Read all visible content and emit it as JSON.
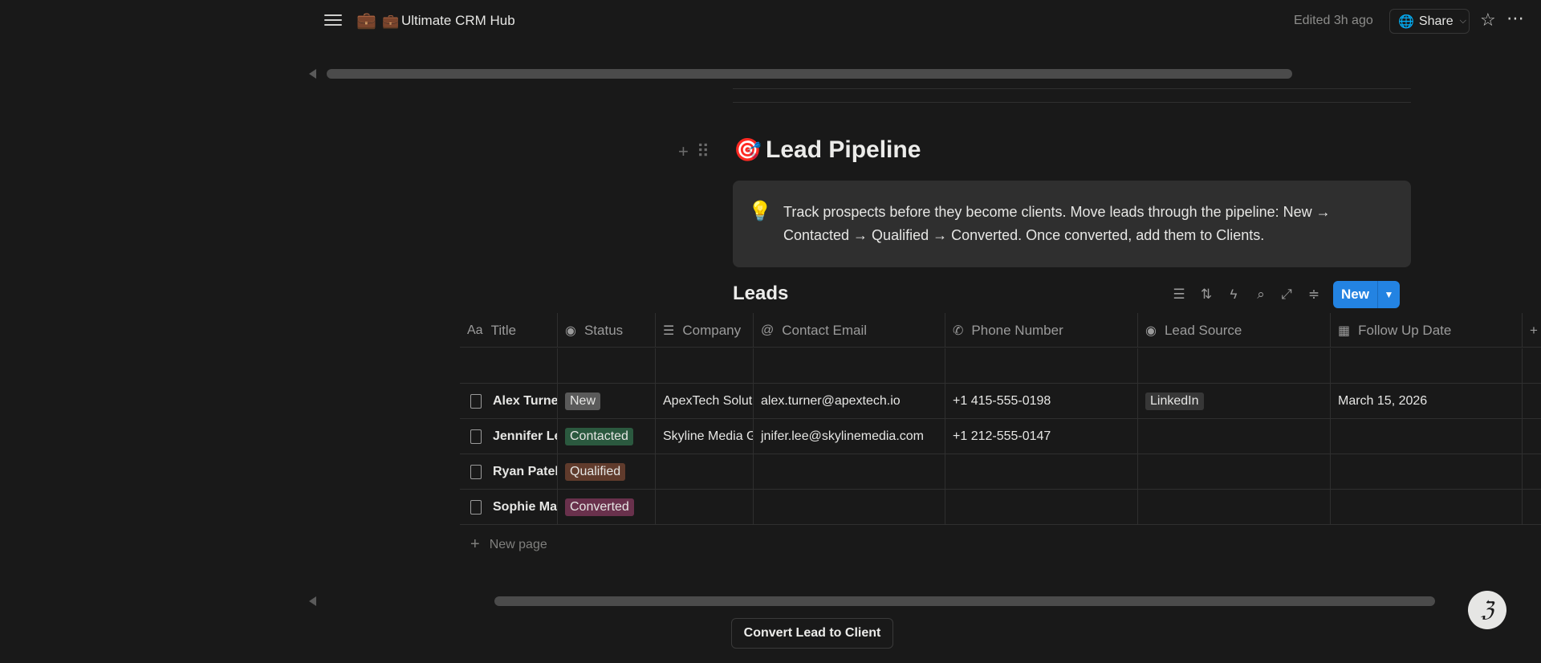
{
  "topbar": {
    "app_title": "Ultimate CRM Hub",
    "edited": "Edited 3h ago",
    "share_label": "Share"
  },
  "page": {
    "heading": "Lead Pipeline",
    "callout": "Track prospects before they become clients. Move leads through the pipeline: New → Contacted → Qualified → Converted. Once converted, add them to Clients."
  },
  "database": {
    "title": "Leads",
    "new_label": "New",
    "columns": [
      "Title",
      "Status",
      "Company",
      "Contact Email",
      "Phone Number",
      "Lead Source",
      "Follow Up Date"
    ],
    "rows": [
      {
        "title": "Alex Turner",
        "status": "New",
        "company": "ApexTech Solutions",
        "email": "alex.turner@apextech.io",
        "phone": "+1 415-555-0198",
        "source": "LinkedIn",
        "follow_up": "March 15, 2026"
      },
      {
        "title": "Jennifer Lee",
        "status": "Contacted",
        "company": "Skyline Media Group",
        "email": "jnifer.lee@skylinemedia.com",
        "phone": "+1 212-555-0147",
        "source": "",
        "follow_up": ""
      },
      {
        "title": "Ryan Patel",
        "status": "Qualified",
        "company": "",
        "email": "",
        "phone": "",
        "source": "",
        "follow_up": ""
      },
      {
        "title": "Sophie Martin",
        "status": "Converted",
        "company": "",
        "email": "",
        "phone": "",
        "source": "",
        "follow_up": ""
      }
    ],
    "new_page_label": "New page"
  },
  "actions": {
    "convert_label": "Convert Lead to Client"
  },
  "colors": {
    "accent": "#2383e2",
    "status_new": "#5a5a5a",
    "status_contacted": "#2b593f",
    "status_qualified": "#603b2c",
    "status_converted": "#69314c"
  }
}
